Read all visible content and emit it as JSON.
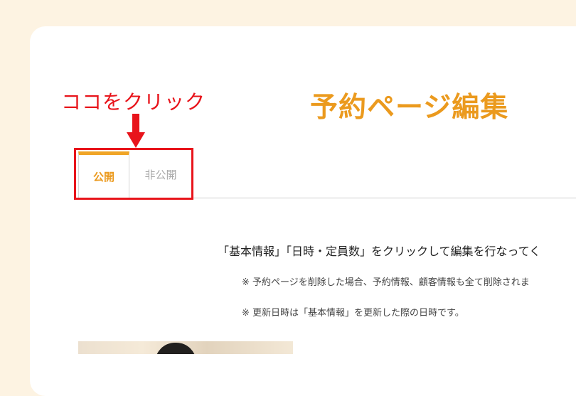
{
  "page": {
    "title": "予約ページ編集"
  },
  "annotation": {
    "text": "ココをクリック",
    "color": "#e8141b"
  },
  "tabs": [
    {
      "label": "公開",
      "active": true
    },
    {
      "label": "非公開",
      "active": false
    }
  ],
  "content": {
    "instruction": "「基本情報」「日時・定員数」をクリックして編集を行なってく",
    "note1": "※ 予約ページを削除した場合、予約情報、顧客情報も全て削除されま",
    "note2": "※ 更新日時は「基本情報」を更新した際の日時です。"
  },
  "colors": {
    "accent": "#eb9a1e",
    "background": "#fdf3e2",
    "annotation": "#e8141b"
  }
}
